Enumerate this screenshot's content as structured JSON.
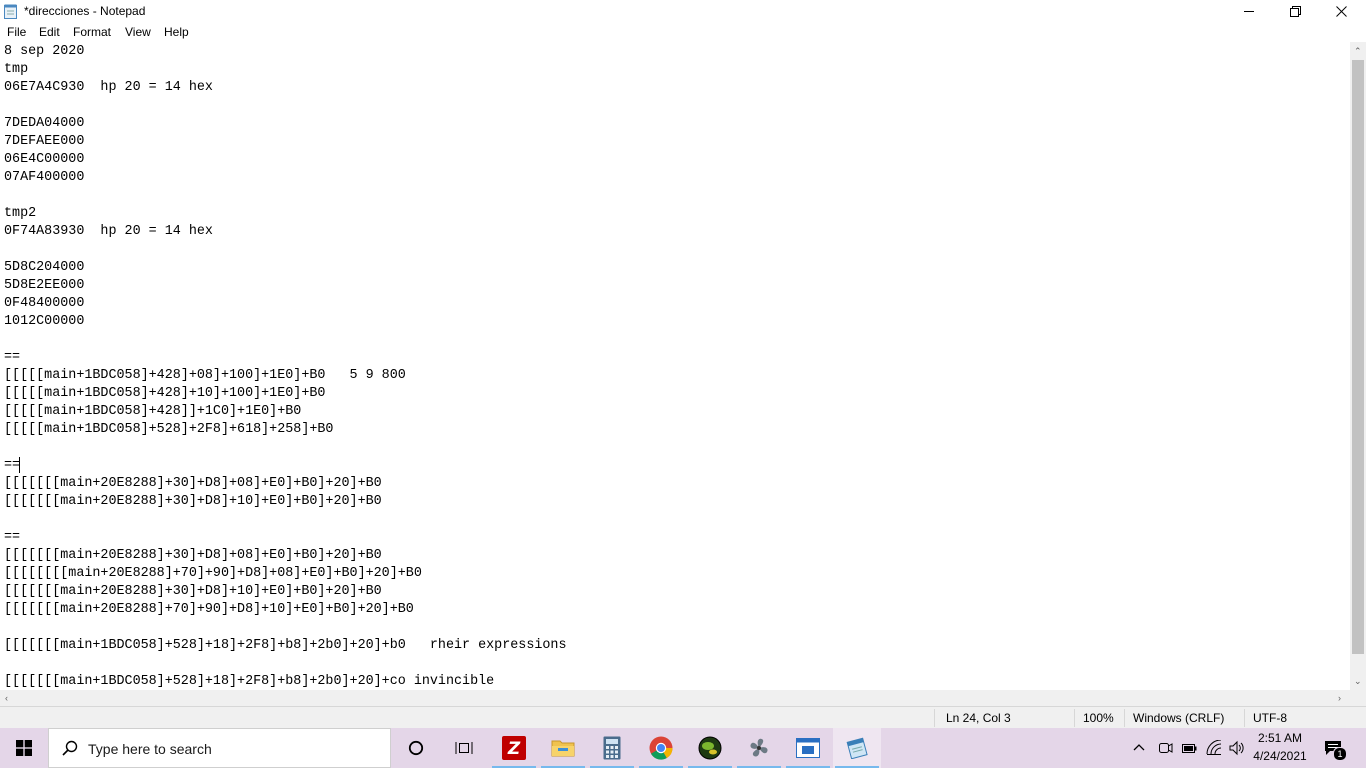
{
  "window": {
    "title": "*direcciones - Notepad",
    "minimize_glyph": "—",
    "close_glyph": "✕"
  },
  "menu": [
    "File",
    "Edit",
    "Format",
    "View",
    "Help"
  ],
  "document": {
    "text": "8 sep 2020\ntmp\n06E7A4C930  hp 20 = 14 hex\n\n7DEDA04000\n7DEFAEE000\n06E4C00000\n07AF400000\n\ntmp2\n0F74A83930  hp 20 = 14 hex\n\n5D8C204000\n5D8E2EE000\n0F48400000\n1012C00000\n\n==\n[[[[[main+1BDC058]+428]+08]+100]+1E0]+B0   5 9 800\n[[[[[main+1BDC058]+428]+10]+100]+1E0]+B0\n[[[[[main+1BDC058]+428]]+1C0]+1E0]+B0\n[[[[[main+1BDC058]+528]+2F8]+618]+258]+B0\n\n==\n[[[[[[[main+20E8288]+30]+D8]+08]+E0]+B0]+20]+B0\n[[[[[[[main+20E8288]+30]+D8]+10]+E0]+B0]+20]+B0\n\n==\n[[[[[[[main+20E8288]+30]+D8]+08]+E0]+B0]+20]+B0\n[[[[[[[[main+20E8288]+70]+90]+D8]+08]+E0]+B0]+20]+B0\n[[[[[[[main+20E8288]+30]+D8]+10]+E0]+B0]+20]+B0\n[[[[[[[main+20E8288]+70]+90]+D8]+10]+E0]+B0]+20]+B0\n\n[[[[[[[main+1BDC058]+528]+18]+2F8]+b8]+2b0]+20]+b0   rheir expressions\n\n[[[[[[[main+1BDC058]+528]+18]+2F8]+b8]+2b0]+20]+co invincible"
  },
  "statusbar": {
    "position": "Ln 24, Col 3",
    "zoom": "100%",
    "line_ending": "Windows (CRLF)",
    "encoding": "UTF-8"
  },
  "taskbar": {
    "search_placeholder": "Type here to search",
    "apps": [
      "cortana-icon",
      "task-view-icon",
      "filezilla-icon",
      "file-explorer-icon",
      "calculator-icon",
      "chrome-icon",
      "globe-app-icon",
      "fan-app-icon",
      "remote-app-icon",
      "notepad-icon"
    ],
    "time": "2:51 AM",
    "date": "4/24/2021",
    "notification_count": "1"
  },
  "colors": {
    "taskbar": "#e4d6e8",
    "active_indicator": "#76b9ed",
    "filezilla": "#bf0000",
    "folder": "#f0c24e"
  }
}
